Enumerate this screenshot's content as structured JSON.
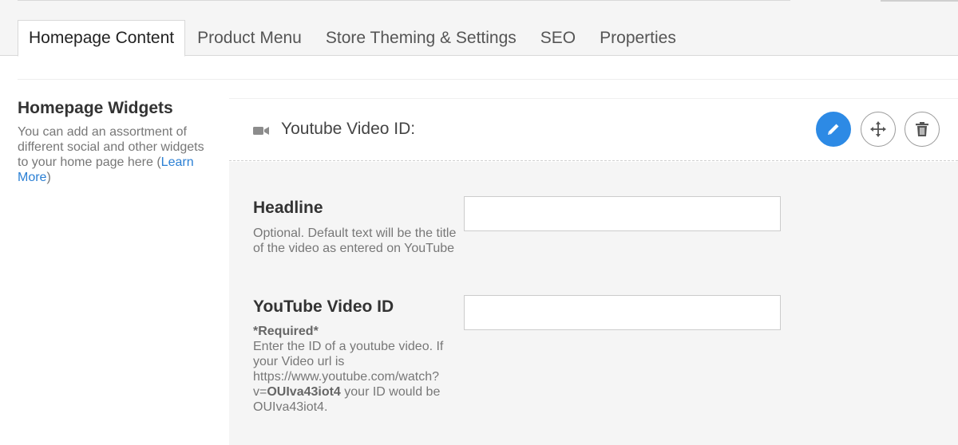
{
  "tabs": [
    {
      "label": "Homepage Content",
      "active": true
    },
    {
      "label": "Product Menu",
      "active": false
    },
    {
      "label": "Store Theming & Settings",
      "active": false
    },
    {
      "label": "SEO",
      "active": false
    },
    {
      "label": "Properties",
      "active": false
    }
  ],
  "sidebar": {
    "title": "Homepage Widgets",
    "description_prefix": "You can add an assortment of different social and other widgets to your home page here (",
    "link_text": "Learn More",
    "description_suffix": ")"
  },
  "widget": {
    "icon": "video-camera-icon",
    "title": "Youtube Video ID:",
    "actions": {
      "edit": "pencil-icon",
      "move": "move-arrows-icon",
      "delete": "trash-icon"
    },
    "accent_color": "#2d8ae5"
  },
  "fields": {
    "headline": {
      "label": "Headline",
      "help": "Optional. Default text will be the title of the video as entered on YouTube",
      "value": "",
      "placeholder": ""
    },
    "video_id": {
      "label": "YouTube Video ID",
      "required": "*Required*",
      "help_prefix": "Enter the ID of a youtube video. If your Video url is https://www.youtube.com/watch?v=",
      "help_example_id": "OUIva43iot4",
      "help_middle": " your ID would be ",
      "help_example_id_plain": "OUIva43iot4",
      "help_suffix": ".",
      "value": "",
      "placeholder": ""
    }
  }
}
